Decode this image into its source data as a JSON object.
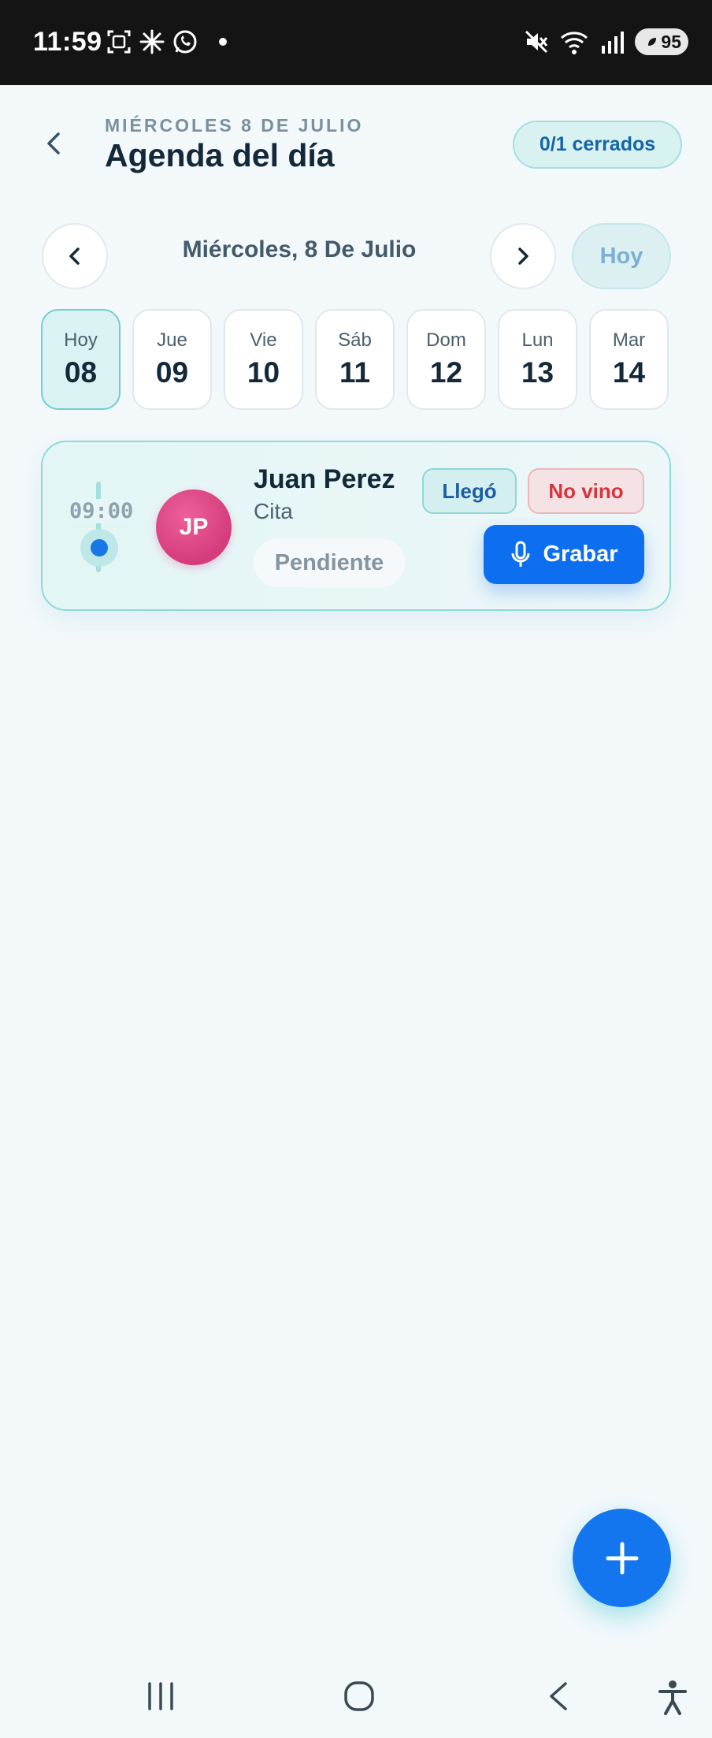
{
  "status_bar": {
    "time": "11:59",
    "battery": "95",
    "icons": [
      "screenshot-icon",
      "sparkle-icon",
      "whatsapp-icon",
      "dot-icon",
      "mute-icon",
      "wifi-icon",
      "signal-icon",
      "battery-icon"
    ]
  },
  "header": {
    "subtitle": "MIÉRCOLES 8 DE JULIO",
    "title": "Agenda del día",
    "closed_count": "0/1 cerrados"
  },
  "date_nav": {
    "current_date": "Miércoles, 8 De Julio",
    "today_label": "Hoy"
  },
  "days": [
    {
      "name": "Hoy",
      "num": "08",
      "active": true
    },
    {
      "name": "Jue",
      "num": "09"
    },
    {
      "name": "Vie",
      "num": "10"
    },
    {
      "name": "Sáb",
      "num": "11"
    },
    {
      "name": "Dom",
      "num": "12"
    },
    {
      "name": "Lun",
      "num": "13"
    },
    {
      "name": "Mar",
      "num": "14"
    }
  ],
  "appointment": {
    "time": "09:00",
    "initials": "JP",
    "name": "Juan Perez",
    "type": "Cita",
    "status": "Pendiente",
    "arrived_label": "Llegó",
    "no_show_label": "No vino",
    "record_label": "Grabar"
  },
  "colors": {
    "accent": "#0d6fef",
    "teal": "#8fd9d8",
    "avatar": "#d43c7c",
    "danger": "#d9343c"
  }
}
